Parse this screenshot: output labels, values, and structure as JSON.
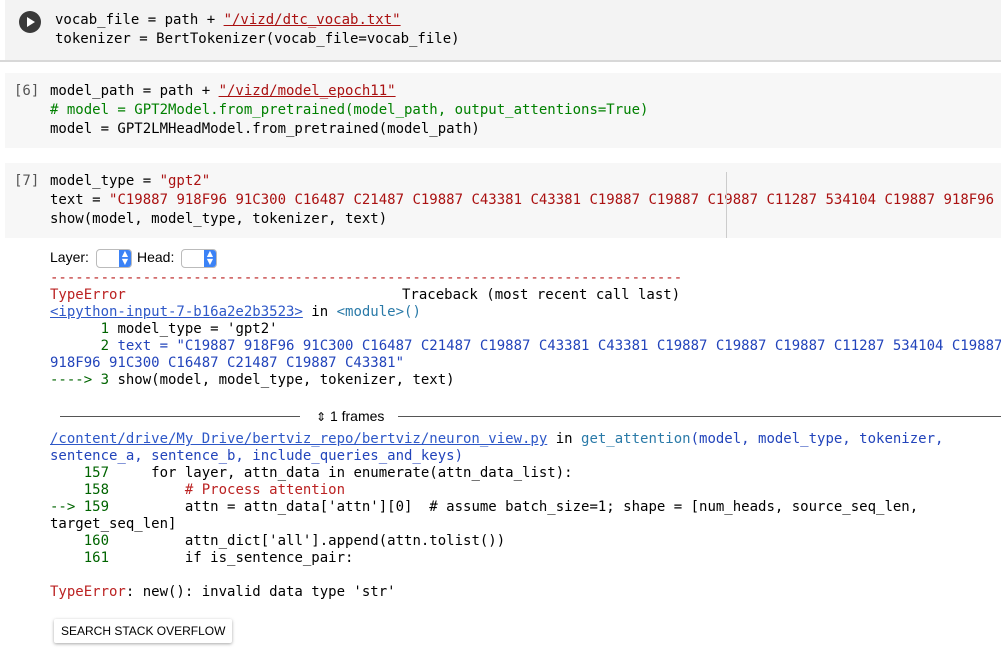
{
  "toolbar": {
    "icons": [
      "move-up-icon",
      "move-down-icon",
      "link-icon",
      "comment-icon",
      "settings-icon",
      "mirror-icon",
      "delete-icon"
    ]
  },
  "cell_top": {
    "line1_a": "vocab_file = path + ",
    "line1_b": "\"/vizd/dtc_vocab.txt\"",
    "line2": "tokenizer = BertTokenizer(vocab_file=vocab_file)"
  },
  "cell6": {
    "prompt": "[6]",
    "line1_a": "model_path = path + ",
    "line1_b": "\"/vizd/model_epoch11\"",
    "line2": "# model = GPT2Model.from_pretrained(model_path, output_attentions=True)",
    "line3": "model = GPT2LMHeadModel.from_pretrained(model_path)"
  },
  "cell7": {
    "prompt": "[7]",
    "line1_a": "model_type = ",
    "line1_b": "\"gpt2\"",
    "line2_a": "text = ",
    "line2_b": "\"C19887 918F96 91C300 C16487 C21487 C19887 C43381 C43381 C19887 C19887 C19887 C11287 534104 C19887 918F96",
    "line3": "show(model, model_type, tokenizer, text)"
  },
  "widgets": {
    "layer_label": "Layer:",
    "head_label": "Head:"
  },
  "traceback": {
    "dashes": "---------------------------------------------------------------------------",
    "error_type": "TypeError",
    "header_right": "Traceback (most recent call last)",
    "input_link": "<ipython-input-7-b16a2e2b3523>",
    "in_word": " in ",
    "module": "<module>()",
    "l1_num": "      1 ",
    "l1_code": "model_type = 'gpt2'",
    "l2_num": "      2 ",
    "l2_code": "text = \"C19887 918F96 91C300 C16487 C21487 C19887 C43381 C43381 C19887 C19887 C19887 C11287 534104 C19887",
    "l2_cont": "918F96 91C300 C16487 C21487 C19887 C43381\"",
    "l3_arrow": "----> 3 ",
    "l3_code": "show(model, model_type, tokenizer, text)",
    "frames_label": "1 frames",
    "file_link": "/content/drive/My Drive/bertviz_repo/bertviz/neuron_view.py",
    "in_word2": " in ",
    "func": "get_attention",
    "func_args": "(model, model_type, tokenizer,",
    "func_args2": "sentence_a, sentence_b, include_queries_and_keys)",
    "f157_num": "    157 ",
    "f157_code": "    for layer, attn_data in enumerate(attn_data_list):",
    "f158_num": "    158 ",
    "f158_code": "        # Process attention",
    "f159_num": "--> 159 ",
    "f159_code": "        attn = attn_data['attn'][0]  # assume batch_size=1; shape = [num_heads, source_seq_len,",
    "f159_cont": "target_seq_len]",
    "f160_num": "    160 ",
    "f160_code": "        attn_dict['all'].append(attn.tolist())",
    "f161_num": "    161 ",
    "f161_code": "        if is_sentence_pair:",
    "final_type": "TypeError",
    "final_msg": ": new(): invalid data type 'str'"
  },
  "so_button": "SEARCH STACK OVERFLOW"
}
